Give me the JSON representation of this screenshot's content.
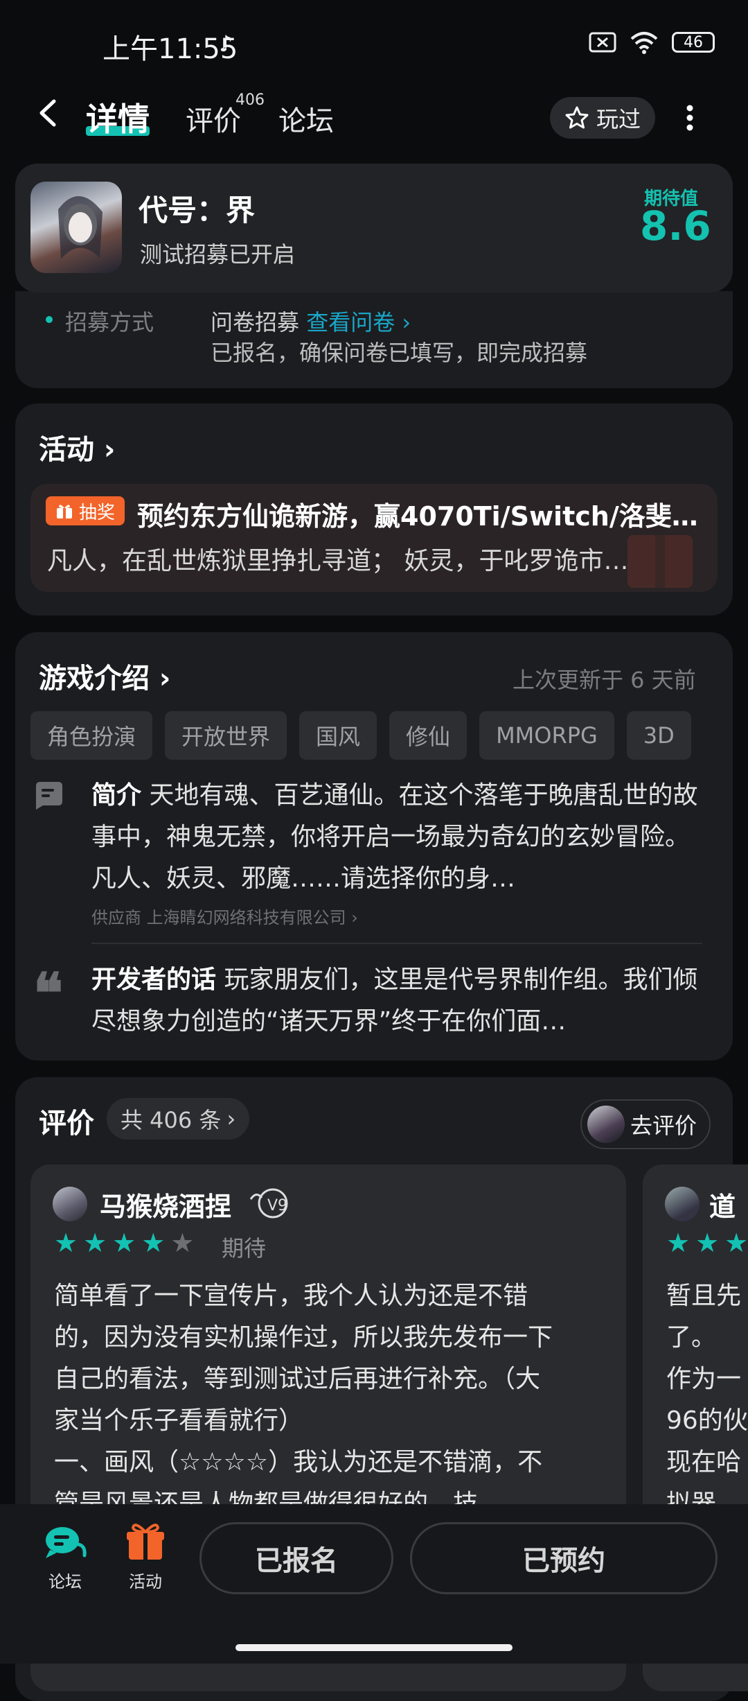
{
  "status_bar": {
    "time": "上午11:55",
    "battery": "46"
  },
  "header": {
    "tabs": [
      {
        "label": "详情"
      },
      {
        "label": "评价"
      },
      {
        "label": "论坛"
      }
    ],
    "review_badge": "406",
    "played_label": "玩过"
  },
  "game": {
    "title": "代号：界",
    "subtitle": "测试招募已开启",
    "expectation_label": "期待值",
    "expectation_value": "8.6"
  },
  "recruit": {
    "label": "招募方式",
    "value": "问卷招募",
    "link": "查看问卷",
    "note": "已报名，确保问卷已填写，即完成招募"
  },
  "activity": {
    "title": "活动",
    "badge": "抽奖",
    "item_title": "预约东方仙诡新游，赢4070Ti/Switch/洛斐…",
    "item_desc": "凡人，在乱世炼狱里挣扎寻道； 妖灵，于叱罗诡市…"
  },
  "intro": {
    "title": "游戏介绍",
    "updated": "上次更新于 6 天前",
    "tags": [
      "角色扮演",
      "开放世界",
      "国风",
      "修仙",
      "MMORPG",
      "3D"
    ],
    "summary_label": "简介",
    "summary_text": "天地有魂、百艺通仙。在这个落笔于晚唐乱世的故事中，神鬼无禁，你将开启一场最为奇幻的玄妙冒险。凡人、妖灵、邪魔……请选择你的身…",
    "supplier_label": "供应商",
    "supplier": "上海睛幻网络科技有限公司",
    "dev_label": "开发者的话",
    "dev_text": "玩家朋友们，这里是代号界制作组。我们倾尽想象力创造的“诸天万界”终于在你们面…"
  },
  "reviews": {
    "title": "评价",
    "count_text": "共 406 条",
    "write_label": "去评价",
    "items": [
      {
        "author": "马猴烧酒捏",
        "stars": 4,
        "tag": "期待",
        "lines": [
          "简单看了一下宣传片，我个人认为还是不错",
          "的，因为没有实机操作过，所以我先发布一下",
          "自己的看法，等到测试过后再进行补充。（大",
          "家当个乐子看看就行）",
          "一、画风（☆☆☆☆）我认为还是不错滴，不",
          "管是风景还是人物都是做得很好的，技"
        ]
      },
      {
        "author": "道",
        "lines": [
          "暂且先",
          "了。",
          "作为一",
          "96的伙",
          "现在哈",
          "拟器"
        ]
      }
    ]
  },
  "bottom_bar": {
    "forum_label": "论坛",
    "activity_label": "活动",
    "signed_label": "已报名",
    "reserved_label": "已预约"
  },
  "colors": {
    "accent": "#13c2b3",
    "lottery": "#f2642a",
    "link": "#1aa6c9",
    "star_off": "#6e6f73"
  },
  "icons": [
    "back-icon",
    "star-badge-icon",
    "more-icon",
    "gift-icon",
    "chat-icon",
    "quote-icon",
    "chevron-right-icon"
  ]
}
